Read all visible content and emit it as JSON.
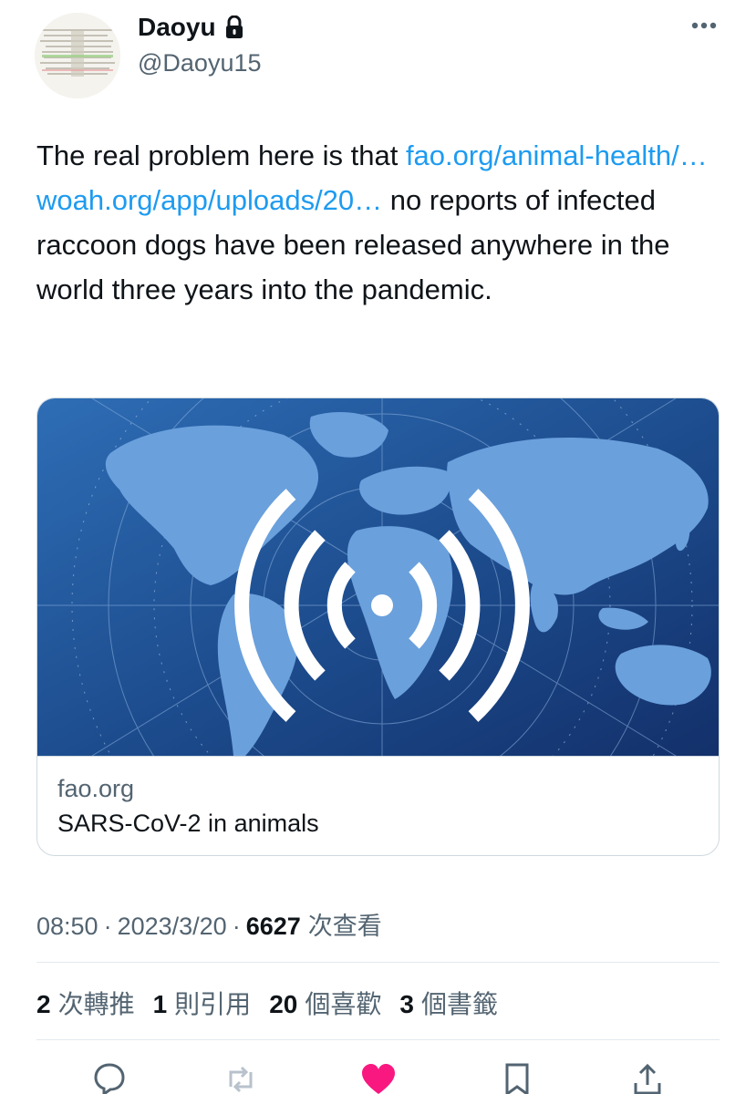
{
  "author": {
    "display_name": "Daoyu",
    "handle": "@Daoyu15",
    "verified_icon": "lock-icon"
  },
  "tweet": {
    "text_before": "The real problem here is that ",
    "link1": "fao.org/animal-health/…",
    "link2": "woah.org/app/uploads/20…",
    "text_after": " no reports of infected raccoon dogs have been released anywhere in the world three years into the pandemic."
  },
  "card": {
    "domain": "fao.org",
    "title": "SARS-CoV-2 in animals",
    "image_icon": "world-map-broadcast-image"
  },
  "meta": {
    "time": "08:50",
    "date": "2023/3/20",
    "views_count": "6627",
    "views_label": "次查看",
    "separator": "·"
  },
  "stats": [
    {
      "count": "2",
      "label": "次轉推"
    },
    {
      "count": "1",
      "label": "則引用"
    },
    {
      "count": "20",
      "label": "個喜歡"
    },
    {
      "count": "3",
      "label": "個書籤"
    }
  ],
  "actions": [
    "reply-icon",
    "retweet-icon",
    "like-icon",
    "bookmark-icon",
    "share-icon"
  ],
  "colors": {
    "link": "#1d9bf0",
    "secondary_text": "#536471",
    "like_active": "#f91880",
    "card_bg": "#1f4a86"
  }
}
